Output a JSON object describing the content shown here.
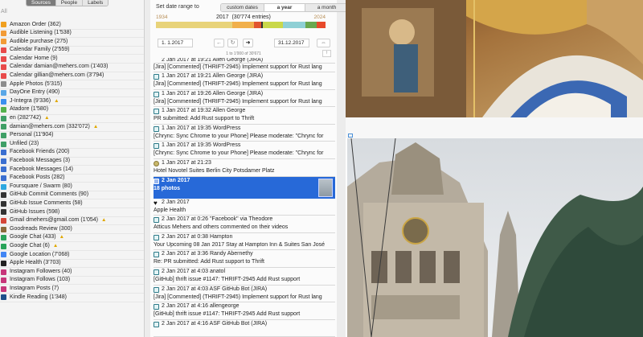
{
  "sidebar": {
    "tabs": [
      "Sources",
      "People",
      "Labels"
    ],
    "active_tab": "Sources",
    "all_label": "All",
    "sources": [
      {
        "label": "Amazon Order (362)",
        "icon": "amazon-icon",
        "color": "#f0a020",
        "warn": false
      },
      {
        "label": "Audible Listening (1'538)",
        "icon": "audible-icon",
        "color": "#f29b36",
        "warn": false
      },
      {
        "label": "Audible purchase (275)",
        "icon": "audible-icon",
        "color": "#f29b36",
        "warn": false
      },
      {
        "label": "Calendar Family (2'559)",
        "icon": "calendar-icon",
        "color": "#e84a4a",
        "warn": false
      },
      {
        "label": "Calendar Home (9)",
        "icon": "calendar-icon",
        "color": "#e84a4a",
        "warn": false
      },
      {
        "label": "Calendar damian@mehers.com (1'403)",
        "icon": "calendar-icon",
        "color": "#e84a4a",
        "warn": false
      },
      {
        "label": "Calendar gillian@mehers.com (3'794)",
        "icon": "calendar-icon",
        "color": "#e84a4a",
        "warn": false
      },
      {
        "label": "Apple Photos (5'315)",
        "icon": "photos-icon",
        "color": "#8c8c8c",
        "warn": false
      },
      {
        "label": "DayOne Entry (490)",
        "icon": "dayone-icon",
        "color": "#5aa7e6",
        "warn": false
      },
      {
        "label": "J-Integra (9'336)",
        "icon": "jira-icon",
        "color": "#3b8ff0",
        "warn": true
      },
      {
        "label": "Atadore (1'580)",
        "icon": "atadore-icon",
        "color": "#55b24d",
        "warn": false
      },
      {
        "label": "en (282'742)",
        "icon": "message-icon",
        "color": "#3f9f66",
        "warn": true
      },
      {
        "label": "damian@mehers.com (332'072)",
        "icon": "message-icon",
        "color": "#3f9f66",
        "warn": true
      },
      {
        "label": "Personal (11'904)",
        "icon": "message-icon",
        "color": "#3f9f66",
        "warn": false
      },
      {
        "label": "Unfiled (23)",
        "icon": "message-icon",
        "color": "#3f9f66",
        "warn": false
      },
      {
        "label": "Facebook Friends (200)",
        "icon": "facebook-icon",
        "color": "#3b6fd0",
        "warn": false
      },
      {
        "label": "Facebook Messages (3)",
        "icon": "facebook-icon",
        "color": "#3b6fd0",
        "warn": false
      },
      {
        "label": "Facebook Messages (14)",
        "icon": "facebook-icon",
        "color": "#3b6fd0",
        "warn": false
      },
      {
        "label": "Facebook Posts (282)",
        "icon": "facebook-icon",
        "color": "#3b6fd0",
        "warn": false
      },
      {
        "label": "Foursquare / Swarm (80)",
        "icon": "foursquare-icon",
        "color": "#2ea8e0",
        "warn": false
      },
      {
        "label": "GitHub Commit Comments (90)",
        "icon": "github-icon",
        "color": "#333333",
        "warn": false
      },
      {
        "label": "GitHub Issue Comments (58)",
        "icon": "github-icon",
        "color": "#333333",
        "warn": false
      },
      {
        "label": "GitHub Issues (598)",
        "icon": "github-icon",
        "color": "#333333",
        "warn": false
      },
      {
        "label": "Gmail dmehers@gmail.com (1'054)",
        "icon": "gmail-icon",
        "color": "#d44638",
        "warn": true
      },
      {
        "label": "Goodreads Review (300)",
        "icon": "goodreads-icon",
        "color": "#8a6a3b",
        "warn": false
      },
      {
        "label": "Google Chat (433)",
        "icon": "google-chat-icon",
        "color": "#2aa35a",
        "warn": true
      },
      {
        "label": "Google Chat (6)",
        "icon": "google-chat-icon",
        "color": "#2aa35a",
        "warn": true
      },
      {
        "label": "Google Location (7'068)",
        "icon": "location-icon",
        "color": "#4285f4",
        "warn": false
      },
      {
        "label": "Apple Health (3'703)",
        "icon": "heart-icon",
        "color": "#222222",
        "warn": false
      },
      {
        "label": "Instagram Followers (40)",
        "icon": "instagram-icon",
        "color": "#c7367a",
        "warn": false
      },
      {
        "label": "Instagram Follows (103)",
        "icon": "instagram-icon",
        "color": "#c7367a",
        "warn": false
      },
      {
        "label": "Instagram Posts (7)",
        "icon": "instagram-icon",
        "color": "#c7367a",
        "warn": false
      },
      {
        "label": "Kindle Reading (1'348)",
        "icon": "kindle-icon",
        "color": "#1c4f8a",
        "warn": false
      }
    ]
  },
  "filter": {
    "label": "Set date range to",
    "options": [
      "custom dates",
      "a year",
      "a month"
    ],
    "active": "a year"
  },
  "yearbar": {
    "start_year": "1934",
    "end_year": "2024",
    "current": "2017",
    "entries": "(30'774 entries)",
    "segment_colors": [
      "#e8d37a",
      "#f1b04c",
      "#e2542f",
      "#c9d84a",
      "#8fd0d5",
      "#6aa84f",
      "#e84a2b"
    ]
  },
  "dates": {
    "start": "1. 1.2017",
    "end": "31.12.2017",
    "count_line": "1 to 1'000 of 30'671"
  },
  "events": [
    {
      "line1": "2 Jan 2017 at 19:21  Allen George (JIRA)",
      "line2": "",
      "first": true
    },
    {
      "line1": "",
      "line2": "[Jira] [Commented] (THRIFT-2945) Implement support for Rust lang",
      "cont": true
    },
    {
      "line1": "1 Jan 2017 at 19:21  Allen George (JIRA)",
      "line2": "[Jira] [Commented] (THRIFT-2945) Implement support for Rust lang"
    },
    {
      "line1": "1 Jan 2017 at 19:26  Allen George (JIRA)",
      "line2": "[Jira] [Commented] (THRIFT-2945) Implement support for Rust lang"
    },
    {
      "line1": "1 Jan 2017 at 19:32  Allen George",
      "line2": "PR submitted: Add Rust support to Thrift"
    },
    {
      "line1": "1 Jan 2017 at 19:35  WordPress",
      "line2": "[Chrync: Sync Chrome to your Phone] Please moderate: \"Chrync for"
    },
    {
      "line1": "1 Jan 2017 at 19:35  WordPress",
      "line2": "[Chrync: Sync Chrome to your Phone] Please moderate: \"Chrync for"
    },
    {
      "line1": "1 Jan 2017 at 21:23",
      "line2": "Hotel Novotel Suites Berlin City Potsdamer Platz",
      "pin": true
    },
    {
      "line1": "2 Jan 2017",
      "line2": "18 photos",
      "selected": true
    },
    {
      "line1": "2 Jan 2017",
      "line2": "Apple Health",
      "heart": true
    },
    {
      "line1": "2 Jan 2017 at 0:26  \"Facebook\" via Theodore",
      "line2": "Atticus Mehers and others commented on their videos"
    },
    {
      "line1": "2 Jan 2017 at 0:38  Hampton",
      "line2": "Your Upcoming 08 Jan 2017 Stay at Hampton Inn & Suites San José"
    },
    {
      "line1": "2 Jan 2017 at 3:36  Randy Abernethy",
      "line2": "Re: PR submitted: Add Rust support to Thrift"
    },
    {
      "line1": "2 Jan 2017 at 4:03  anatol",
      "line2": "[GitHub] thrift issue #1147: THRIFT-2945 Add Rust support"
    },
    {
      "line1": "2 Jan 2017 at 4:03  ASF GitHub Bot (JIRA)",
      "line2": "[Jira] [Commented] (THRIFT-2945) Implement support for Rust lang"
    },
    {
      "line1": "2 Jan 2017 at 4:16  allengeorge",
      "line2": "[GitHub] thrift issue #1147: THRIFT-2945 Add Rust support"
    },
    {
      "line1": "2 Jan 2017 at 4:16  ASF GitHub Bot (JIRA)",
      "line2": ""
    }
  ]
}
